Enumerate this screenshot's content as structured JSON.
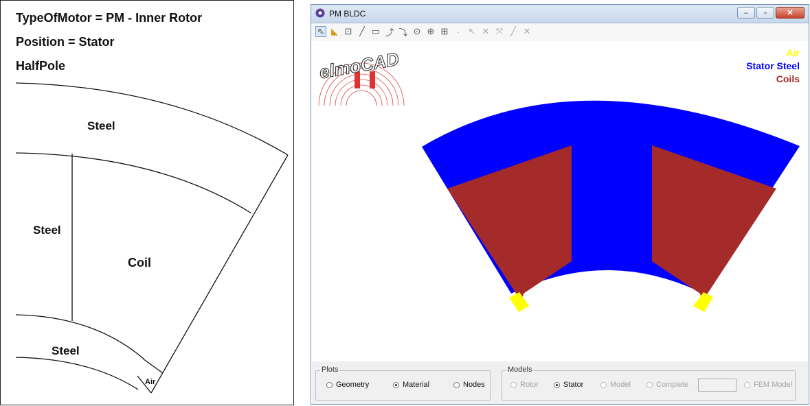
{
  "left_panel": {
    "lines": [
      "TypeOfMotor = PM - Inner Rotor",
      "Position = Stator",
      "HalfPole"
    ],
    "regions": {
      "steel_top": "Steel",
      "steel_left": "Steel",
      "coil": "Coil",
      "steel_bottom": "Steel",
      "air": "Air"
    }
  },
  "window": {
    "title": "PM BLDC",
    "controls": {
      "minimize": "–",
      "maximize": "▫",
      "close": "✕"
    },
    "logo_text": "elmoCAD",
    "legend": [
      {
        "label": "Air",
        "color": "#ffff00"
      },
      {
        "label": "Stator Steel",
        "color": "#0000ff"
      },
      {
        "label": "Coils",
        "color": "#a52a2a"
      }
    ],
    "toolbar_icons": [
      "pointer-icon",
      "ruler-icon",
      "zoom-window-icon",
      "line-icon",
      "rectangle-icon",
      "arc-icon",
      "arc2-icon",
      "circle-icon",
      "zoom-in-icon",
      "zoom-fit-icon",
      "point-icon",
      "select-node-icon",
      "delete-node-icon",
      "move-node-icon",
      "segment-icon",
      "delete-icon"
    ],
    "plots": {
      "title": "Plots",
      "options": [
        {
          "label": "Geometry",
          "selected": false
        },
        {
          "label": "Material",
          "selected": true
        },
        {
          "label": "Nodes",
          "selected": false
        }
      ]
    },
    "models": {
      "title": "Models",
      "options": [
        {
          "label": "Rotor",
          "selected": false,
          "enabled": false
        },
        {
          "label": "Stator",
          "selected": true,
          "enabled": true
        },
        {
          "label": "Model",
          "selected": false,
          "enabled": false
        },
        {
          "label": "Complete",
          "selected": false,
          "enabled": false
        },
        {
          "label": "FEM Model",
          "selected": false,
          "enabled": false
        }
      ],
      "text_value": ""
    }
  }
}
